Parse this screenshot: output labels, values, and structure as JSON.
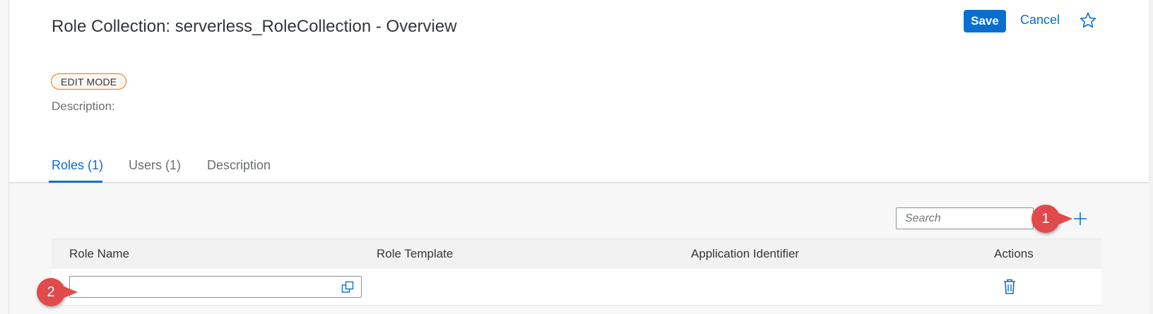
{
  "page": {
    "title": "Role Collection: serverless_RoleCollection - Overview",
    "mode_badge": "EDIT MODE",
    "description_label": "Description:"
  },
  "header_actions": {
    "save_label": "Save",
    "cancel_label": "Cancel",
    "favorite_icon": "star-outline-icon"
  },
  "tabs": [
    {
      "label": "Roles (1)",
      "active": true
    },
    {
      "label": "Users (1)",
      "active": false
    },
    {
      "label": "Description",
      "active": false
    }
  ],
  "toolbar": {
    "search_placeholder": "Search",
    "add_icon": "plus-icon"
  },
  "table": {
    "columns": [
      "Role Name",
      "Role Template",
      "Application Identifier",
      "Actions"
    ],
    "rows": [
      {
        "role_name": "",
        "role_template": "",
        "application_identifier": "",
        "action_icon": "trash-icon"
      }
    ]
  },
  "callouts": [
    "1",
    "2"
  ],
  "colors": {
    "accent": "#0a6ed1",
    "edit_badge_border": "#e9730c",
    "callout": "#e04a4a"
  }
}
